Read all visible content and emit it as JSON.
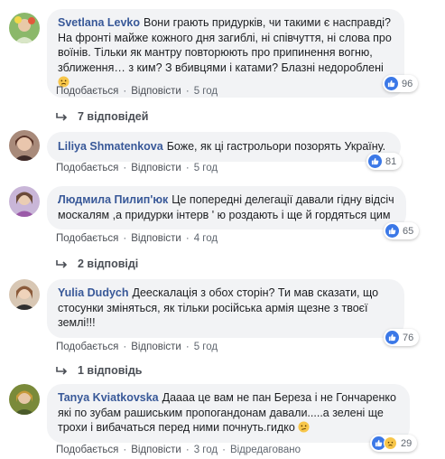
{
  "comments": [
    {
      "author": "Svetlana Levko",
      "text": "Вони грають придурків, чи такими є насправді? На фронті майже кожного дня загиблі, ні співчуття, ні слова про воїнів. Тільки як мантру повторюють про припинення вогню, зближення… з ким? З вбивцями і катами? Блазні недороблені",
      "emoji": "sad-face",
      "reaction_count": "96",
      "like_label": "Подобається",
      "reply_label": "Відповісти",
      "time": "5 год",
      "replies_label": "7 відповідей"
    },
    {
      "author": "Liliya Shmatenkova",
      "text": "Боже, як ці гастрольори позорять Україну.",
      "reaction_count": "81",
      "like_label": "Подобається",
      "reply_label": "Відповісти",
      "time": "5 год"
    },
    {
      "author": "Людмила Пилип'юк",
      "text": "Це попередні делегації давали гідну відсіч москалям ,а придурки інтерв ' ю роздають і ще й гордяться цим",
      "reaction_count": "65",
      "like_label": "Подобається",
      "reply_label": "Відповісти",
      "time": "4 год",
      "replies_label": "2 відповіді"
    },
    {
      "author": "Yulia Dudych",
      "text": "Деескалація з обох сторін? Ти мав сказати, що стосунки зміняться, як тільки російська армія щезне з твоєї землі!!!",
      "reaction_count": "76",
      "like_label": "Подобається",
      "reply_label": "Відповісти",
      "time": "5 год",
      "replies_label": "1 відповідь"
    },
    {
      "author": "Tanya Kviatkovska",
      "text": "Даааа це вам не пан Береза і не Гончаренко які по зубам рашиським пропогандонам давали.....а зелені ще трохи і вибачаться перед ними почнуть.гидко",
      "emoji": "confused-face",
      "reaction_count": "29",
      "like_label": "Подобається",
      "reply_label": "Відповісти",
      "time": "3 год",
      "edited_label": "Відредаговано"
    }
  ],
  "colors": {
    "author": "#385898",
    "bubble": "#f2f3f5",
    "meta": "#606770",
    "like": "#3b78e7"
  }
}
